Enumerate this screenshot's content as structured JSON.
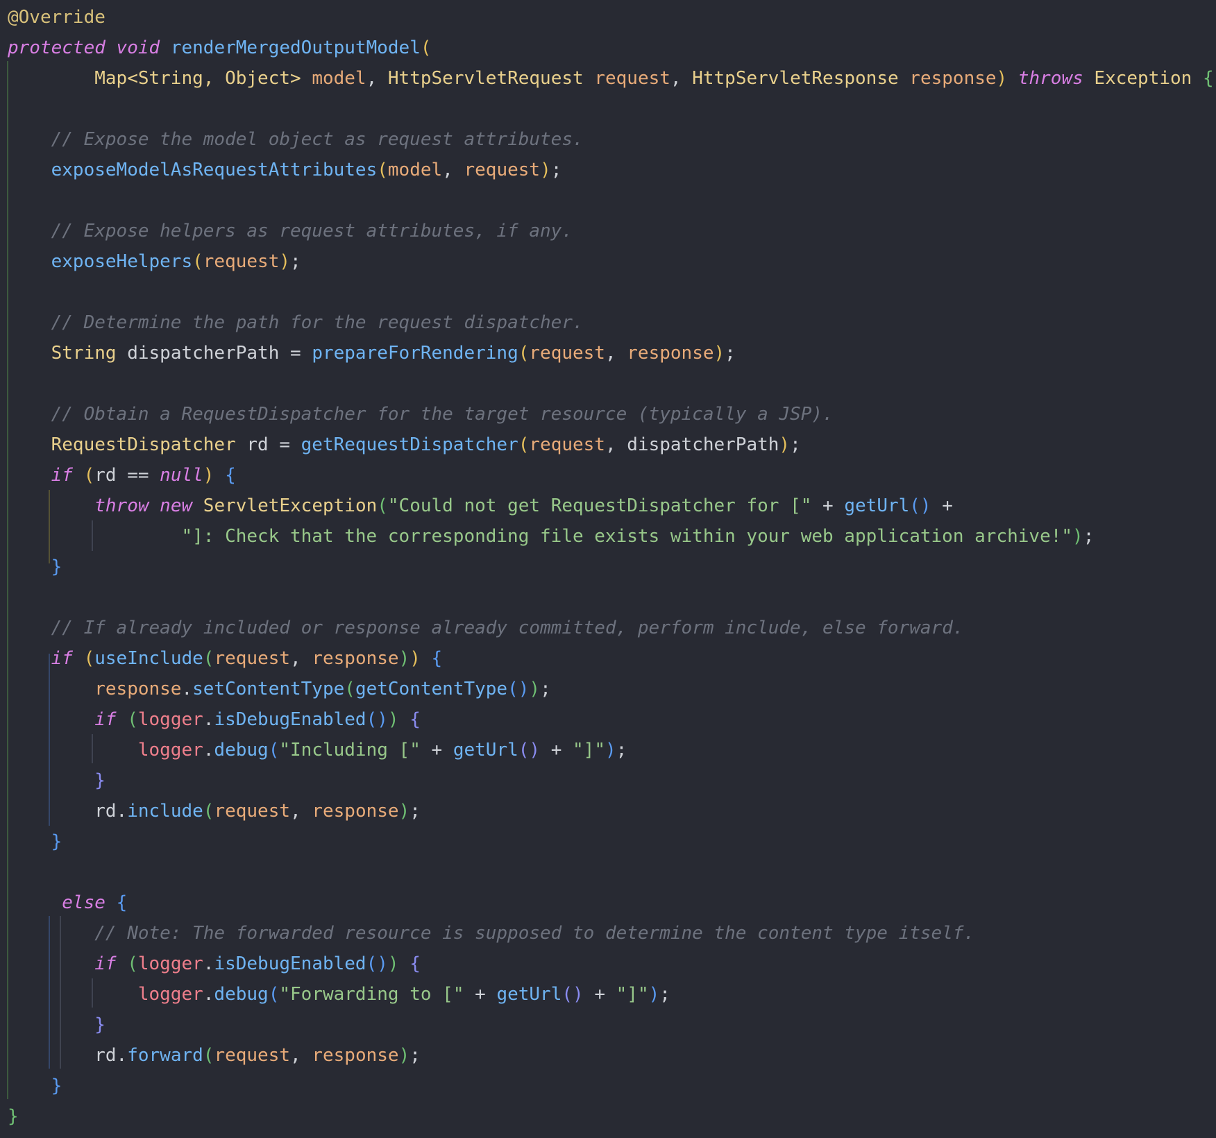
{
  "editor": {
    "language": "java",
    "lines": [
      [
        [
          "@Override",
          "ann"
        ]
      ],
      [
        [
          "protected",
          "kw"
        ],
        [
          " ",
          "plain"
        ],
        [
          "void",
          "kw"
        ],
        [
          " ",
          "plain"
        ],
        [
          "renderMergedOutputModel",
          "fn"
        ],
        [
          "(",
          "b-gold"
        ]
      ],
      [
        [
          "        ",
          "plain"
        ],
        [
          "Map<String, Object>",
          "type"
        ],
        [
          " ",
          "plain"
        ],
        [
          "model",
          "param"
        ],
        [
          ", ",
          "plain"
        ],
        [
          "HttpServletRequest",
          "type"
        ],
        [
          " ",
          "plain"
        ],
        [
          "request",
          "param"
        ],
        [
          ", ",
          "plain"
        ],
        [
          "HttpServletResponse",
          "type"
        ],
        [
          " ",
          "plain"
        ],
        [
          "response",
          "param"
        ],
        [
          ")",
          "b-gold"
        ],
        [
          " ",
          "plain"
        ],
        [
          "throws",
          "kw"
        ],
        [
          " ",
          "plain"
        ],
        [
          "Exception",
          "type"
        ],
        [
          " ",
          "plain"
        ],
        [
          "{",
          "b-green"
        ]
      ],
      [],
      [
        [
          "    ",
          "plain"
        ],
        [
          "// Expose the model object as request attributes.",
          "com"
        ]
      ],
      [
        [
          "    ",
          "plain"
        ],
        [
          "exposeModelAsRequestAttributes",
          "fn"
        ],
        [
          "(",
          "b-gold"
        ],
        [
          "model",
          "param"
        ],
        [
          ", ",
          "plain"
        ],
        [
          "request",
          "param"
        ],
        [
          ")",
          "b-gold"
        ],
        [
          ";",
          "plain"
        ]
      ],
      [],
      [
        [
          "    ",
          "plain"
        ],
        [
          "// Expose helpers as request attributes, if any.",
          "com"
        ]
      ],
      [
        [
          "    ",
          "plain"
        ],
        [
          "exposeHelpers",
          "fn"
        ],
        [
          "(",
          "b-gold"
        ],
        [
          "request",
          "param"
        ],
        [
          ")",
          "b-gold"
        ],
        [
          ";",
          "plain"
        ]
      ],
      [],
      [
        [
          "    ",
          "plain"
        ],
        [
          "// Determine the path for the request dispatcher.",
          "com"
        ]
      ],
      [
        [
          "    ",
          "plain"
        ],
        [
          "String",
          "type"
        ],
        [
          " dispatcherPath = ",
          "plain"
        ],
        [
          "prepareForRendering",
          "fn"
        ],
        [
          "(",
          "b-gold"
        ],
        [
          "request",
          "param"
        ],
        [
          ", ",
          "plain"
        ],
        [
          "response",
          "param"
        ],
        [
          ")",
          "b-gold"
        ],
        [
          ";",
          "plain"
        ]
      ],
      [],
      [
        [
          "    ",
          "plain"
        ],
        [
          "// Obtain a RequestDispatcher for the target resource (typically a JSP).",
          "com"
        ]
      ],
      [
        [
          "    ",
          "plain"
        ],
        [
          "RequestDispatcher",
          "type"
        ],
        [
          " rd = ",
          "plain"
        ],
        [
          "getRequestDispatcher",
          "fn"
        ],
        [
          "(",
          "b-gold"
        ],
        [
          "request",
          "param"
        ],
        [
          ", dispatcherPath",
          "plain"
        ],
        [
          ")",
          "b-gold"
        ],
        [
          ";",
          "plain"
        ]
      ],
      [
        [
          "    ",
          "plain"
        ],
        [
          "if",
          "kw"
        ],
        [
          " ",
          "plain"
        ],
        [
          "(",
          "b-gold"
        ],
        [
          "rd == ",
          "plain"
        ],
        [
          "null",
          "kw"
        ],
        [
          ")",
          "b-gold"
        ],
        [
          " ",
          "plain"
        ],
        [
          "{",
          "b-blue"
        ]
      ],
      [
        [
          "        ",
          "plain"
        ],
        [
          "throw",
          "kw"
        ],
        [
          " ",
          "plain"
        ],
        [
          "new",
          "kw"
        ],
        [
          " ",
          "plain"
        ],
        [
          "ServletException",
          "type"
        ],
        [
          "(",
          "b-green"
        ],
        [
          "\"Could not get RequestDispatcher for [\"",
          "str"
        ],
        [
          " + ",
          "plain"
        ],
        [
          "getUrl",
          "fn"
        ],
        [
          "()",
          "b-blue"
        ],
        [
          " +",
          "plain"
        ]
      ],
      [
        [
          "                ",
          "plain"
        ],
        [
          "\"]: Check that the corresponding file exists within your web application archive!\"",
          "str"
        ],
        [
          ")",
          "b-green"
        ],
        [
          ";",
          "plain"
        ]
      ],
      [
        [
          "    ",
          "plain"
        ],
        [
          "}",
          "b-blue"
        ]
      ],
      [],
      [
        [
          "    ",
          "plain"
        ],
        [
          "// If already included or response already committed, perform include, else forward.",
          "com"
        ]
      ],
      [
        [
          "    ",
          "plain"
        ],
        [
          "if",
          "kw"
        ],
        [
          " ",
          "plain"
        ],
        [
          "(",
          "b-gold"
        ],
        [
          "useInclude",
          "fn"
        ],
        [
          "(",
          "b-green"
        ],
        [
          "request",
          "param"
        ],
        [
          ", ",
          "plain"
        ],
        [
          "response",
          "param"
        ],
        [
          ")",
          "b-green"
        ],
        [
          ")",
          "b-gold"
        ],
        [
          " ",
          "plain"
        ],
        [
          "{",
          "b-blue"
        ]
      ],
      [
        [
          "        ",
          "plain"
        ],
        [
          "response",
          "param"
        ],
        [
          ".",
          "plain"
        ],
        [
          "setContentType",
          "fn"
        ],
        [
          "(",
          "b-green"
        ],
        [
          "getContentType",
          "fn"
        ],
        [
          "()",
          "b-blue"
        ],
        [
          ")",
          "b-green"
        ],
        [
          ";",
          "plain"
        ]
      ],
      [
        [
          "        ",
          "plain"
        ],
        [
          "if",
          "kw"
        ],
        [
          " ",
          "plain"
        ],
        [
          "(",
          "b-green"
        ],
        [
          "logger",
          "field"
        ],
        [
          ".",
          "plain"
        ],
        [
          "isDebugEnabled",
          "fn"
        ],
        [
          "()",
          "b-blue"
        ],
        [
          ")",
          "b-green"
        ],
        [
          " ",
          "plain"
        ],
        [
          "{",
          "b-purple"
        ]
      ],
      [
        [
          "            ",
          "plain"
        ],
        [
          "logger",
          "field"
        ],
        [
          ".",
          "plain"
        ],
        [
          "debug",
          "fn"
        ],
        [
          "(",
          "b-blue"
        ],
        [
          "\"Including [\"",
          "str"
        ],
        [
          " + ",
          "plain"
        ],
        [
          "getUrl",
          "fn"
        ],
        [
          "()",
          "b-purple"
        ],
        [
          " + ",
          "plain"
        ],
        [
          "\"]\"",
          "str"
        ],
        [
          ")",
          "b-blue"
        ],
        [
          ";",
          "plain"
        ]
      ],
      [
        [
          "        ",
          "plain"
        ],
        [
          "}",
          "b-purple"
        ]
      ],
      [
        [
          "        ",
          "plain"
        ],
        [
          "rd.",
          "plain"
        ],
        [
          "include",
          "fn"
        ],
        [
          "(",
          "b-green"
        ],
        [
          "request",
          "param"
        ],
        [
          ", ",
          "plain"
        ],
        [
          "response",
          "param"
        ],
        [
          ")",
          "b-green"
        ],
        [
          ";",
          "plain"
        ]
      ],
      [
        [
          "    ",
          "plain"
        ],
        [
          "}",
          "b-blue"
        ]
      ],
      [],
      [
        [
          "     ",
          "plain"
        ],
        [
          "else",
          "kw"
        ],
        [
          " ",
          "plain"
        ],
        [
          "{",
          "b-blue"
        ]
      ],
      [
        [
          "        ",
          "plain"
        ],
        [
          "// Note: The forwarded resource is supposed to determine the content type itself.",
          "com"
        ]
      ],
      [
        [
          "        ",
          "plain"
        ],
        [
          "if",
          "kw"
        ],
        [
          " ",
          "plain"
        ],
        [
          "(",
          "b-green"
        ],
        [
          "logger",
          "field"
        ],
        [
          ".",
          "plain"
        ],
        [
          "isDebugEnabled",
          "fn"
        ],
        [
          "()",
          "b-blue"
        ],
        [
          ")",
          "b-green"
        ],
        [
          " ",
          "plain"
        ],
        [
          "{",
          "b-purple"
        ]
      ],
      [
        [
          "            ",
          "plain"
        ],
        [
          "logger",
          "field"
        ],
        [
          ".",
          "plain"
        ],
        [
          "debug",
          "fn"
        ],
        [
          "(",
          "b-blue"
        ],
        [
          "\"Forwarding to [\"",
          "str"
        ],
        [
          " + ",
          "plain"
        ],
        [
          "getUrl",
          "fn"
        ],
        [
          "()",
          "b-purple"
        ],
        [
          " + ",
          "plain"
        ],
        [
          "\"]\"",
          "str"
        ],
        [
          ")",
          "b-blue"
        ],
        [
          ";",
          "plain"
        ]
      ],
      [
        [
          "        ",
          "plain"
        ],
        [
          "}",
          "b-purple"
        ]
      ],
      [
        [
          "        ",
          "plain"
        ],
        [
          "rd.",
          "plain"
        ],
        [
          "forward",
          "fn"
        ],
        [
          "(",
          "b-green"
        ],
        [
          "request",
          "param"
        ],
        [
          ", ",
          "plain"
        ],
        [
          "response",
          "param"
        ],
        [
          ")",
          "b-green"
        ],
        [
          ";",
          "plain"
        ]
      ],
      [
        [
          "    ",
          "plain"
        ],
        [
          "}",
          "b-blue"
        ]
      ],
      [
        [
          "}",
          "b-green"
        ]
      ]
    ]
  },
  "colors": {
    "background": "#282a33",
    "keyword": "#d97fe4",
    "method": "#6fb4f3",
    "type": "#e9d08c",
    "parameter": "#e8ab79",
    "comment": "#6d727e",
    "string": "#98c88a",
    "field": "#ef7f8c",
    "annotation": "#d7c07a"
  }
}
